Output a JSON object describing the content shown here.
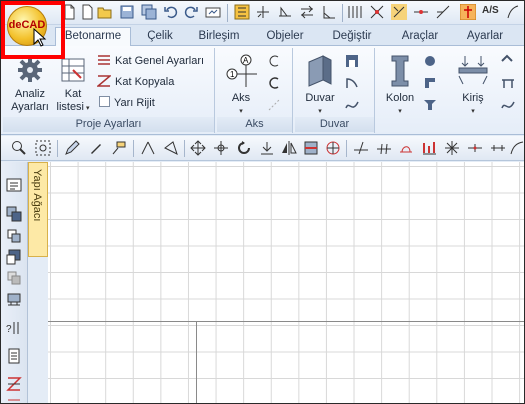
{
  "app": {
    "logo_text": "deCAD"
  },
  "quick_access": {
    "icons": [
      "new-file-icon",
      "open-folder-icon",
      "save-icon",
      "save-all-icon",
      "undo-icon",
      "redo-icon",
      "print-icon",
      "layers-icon",
      "toggle-icon",
      "dimension-icon",
      "align-icon",
      "angle-icon",
      "snap-icon",
      "node-icon",
      "magnet-icon",
      "line-icon",
      "extend-icon",
      "cursor-tool-icon",
      "text-style-icon",
      "more-icon"
    ],
    "text_style_label": "A/S"
  },
  "tabs": [
    {
      "label": "Betonarme",
      "active": true
    },
    {
      "label": "Çelik"
    },
    {
      "label": "Birleşim"
    },
    {
      "label": "Objeler"
    },
    {
      "label": "Değiştir"
    },
    {
      "label": "Araçlar"
    },
    {
      "label": "Ayarlar"
    }
  ],
  "ribbon": {
    "proje": {
      "label": "Proje Ayarları",
      "analiz": "Analiz\nAyarları",
      "analiz_line1": "Analiz",
      "analiz_line2": "Ayarları",
      "kat_line1": "Kat",
      "kat_line2": "listesi",
      "kat_genel": "Kat Genel Ayarları",
      "kat_kopyala": "Kat Kopyala",
      "yari_rijit": "Yarı Rijit"
    },
    "aks": {
      "label": "Aks",
      "button": "Aks"
    },
    "duvar": {
      "label": "Duvar",
      "button": "Duvar"
    },
    "kolon": {
      "button": "Kolon"
    },
    "kiris": {
      "button": "Kiriş"
    }
  },
  "side_panel": {
    "tab_label": "Yapı Ağacı"
  },
  "colors": {
    "highlight": "#ff0000",
    "ribbon_bg": "#e5edf8",
    "panel_tab": "#fde9a6"
  }
}
